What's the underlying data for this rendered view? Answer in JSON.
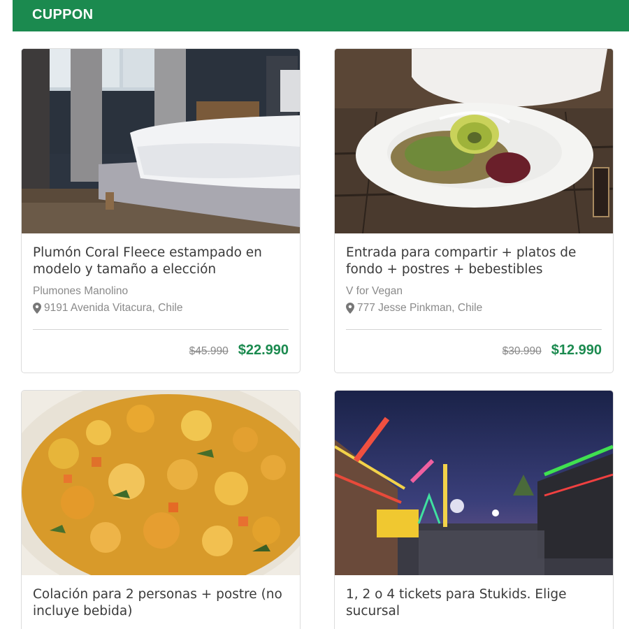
{
  "header": {
    "brand": "CUPPON",
    "accent_color": "#1b8a4f"
  },
  "cards": [
    {
      "image": "bedroom-photo",
      "title": "Plumón Coral Fleece estampado en modelo y tamaño a elección",
      "merchant": "Plumones Manolino",
      "address": "9191 Avenida Vitacura, Chile",
      "old_price": "$45.990",
      "new_price": "$22.990"
    },
    {
      "image": "vegan-salad-photo",
      "title": "Entrada para compartir + platos de fondo + postres + bebestibles",
      "merchant": "V for Vegan",
      "address": "777 Jesse Pinkman, Chile",
      "old_price": "$30.990",
      "new_price": "$12.990"
    },
    {
      "image": "vegetable-stew-photo",
      "title": "Colación para 2 personas + postre (no incluye bebida)"
    },
    {
      "image": "night-fair-photo",
      "title": "1, 2 o 4 tickets para Stukids. Elige sucursal"
    }
  ]
}
